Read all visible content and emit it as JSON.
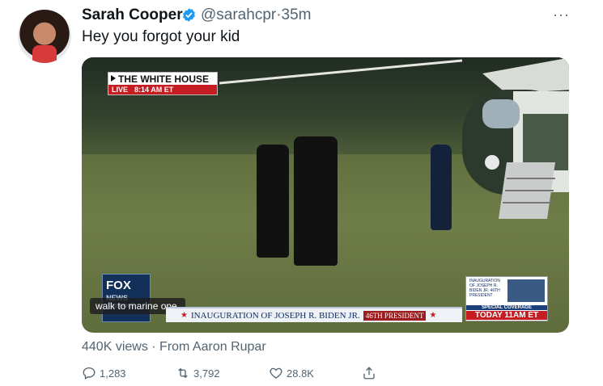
{
  "tweet": {
    "author_name": "Sarah Cooper",
    "handle": "@sarahcpr",
    "time": "35m",
    "text": "Hey you forgot your kid",
    "more_label": "···"
  },
  "video": {
    "badge_title": "THE WHITE HOUSE",
    "badge_live": "LIVE",
    "badge_time": "8:14 AM ET",
    "network_logo_line1": "FOX",
    "network_logo_line2": "NEWS channel",
    "caption": "walk to marine one.",
    "ticker_text": "INAUGURATION OF JOSEPH R. BIDEN JR.",
    "ticker_tag": "46TH PRESIDENT",
    "promo_small": "INAUGURATION OF JOSEPH R. BIDEN JR. 46TH PRESIDENT",
    "promo_coverage": "SPECIAL COVERAGE",
    "promo_time": "TODAY 11AM ET"
  },
  "meta": {
    "views_text": "440K views · From Aaron Rupar"
  },
  "actions": {
    "replies": "1,283",
    "retweets": "3,792",
    "likes": "28.8K"
  },
  "colors": {
    "accent_verified": "#1d9bf0",
    "secondary_text": "#536471"
  }
}
